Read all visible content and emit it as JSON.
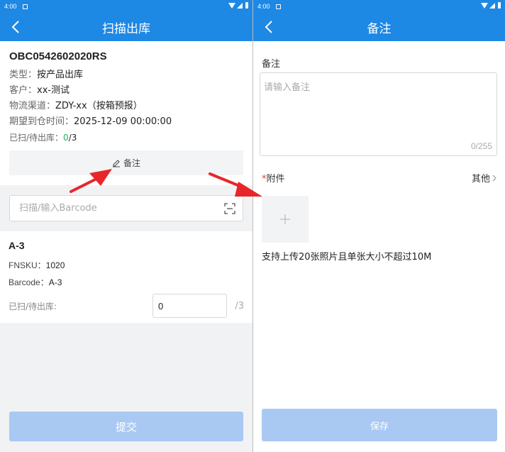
{
  "left": {
    "status": {
      "time": "4:00"
    },
    "appbar": {
      "title": "扫描出库"
    },
    "order": {
      "number": "OBC0542602020RS",
      "type_label": "类型：",
      "type_value": "按产品出库",
      "customer_label": "客户：",
      "customer_value": "xx-测试",
      "channel_label": "物流渠道：",
      "channel_value": "ZDY-xx（按箱预报）",
      "eta_label": "期望到仓时间：",
      "eta_value": "2025-12-09 00:00:00",
      "progress_label": "已扫/待出库：",
      "scanned": "0",
      "progress_total": "/3"
    },
    "remark_button": "备注",
    "scan": {
      "placeholder": "扫描/输入Barcode"
    },
    "item": {
      "code": "A-3",
      "fnsku_label": "FNSKU：",
      "fnsku_value": "1020",
      "barcode_label": "Barcode：",
      "barcode_value": "A-3",
      "qty_label": "已扫/待出库:",
      "qty_value": "0",
      "qty_total": "/3"
    },
    "submit_button": "提交"
  },
  "right": {
    "status": {
      "time": "4:00"
    },
    "appbar": {
      "title": "备注"
    },
    "remark_label": "备注",
    "remark_placeholder": "请输入备注",
    "remark_counter": "0/255",
    "required_mark": "*",
    "attachment_label": "附件",
    "other_link": "其他",
    "upload_hint": "支持上传20张照片且单张大小不超过10M",
    "save_button": "保存"
  },
  "colors": {
    "primary": "#1e88e5",
    "button_disabled": "#a9c9f3",
    "annotation_arrow": "#e8262a",
    "scanned_count": "#27ae60",
    "required": "#e53935"
  }
}
